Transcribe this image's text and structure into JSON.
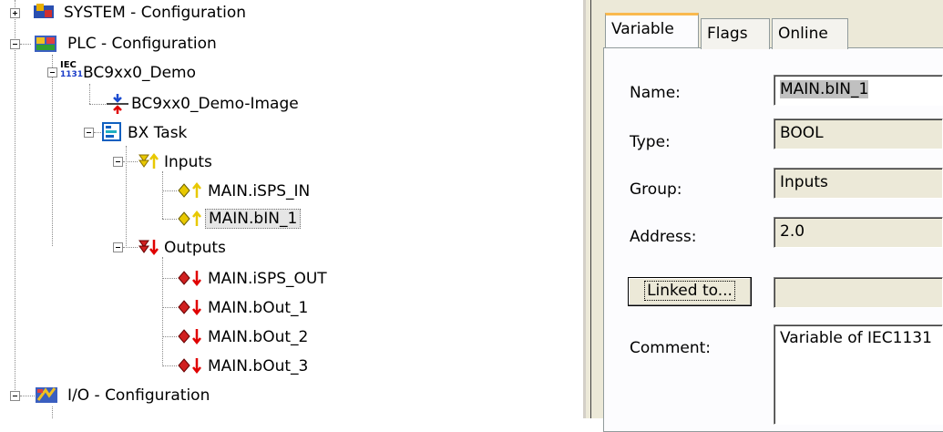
{
  "tree": {
    "system": "SYSTEM - Configuration",
    "plc": "PLC - Configuration",
    "project": "BC9xx0_Demo",
    "image": "BC9xx0_Demo-Image",
    "task": "BX Task",
    "inputs": "Inputs",
    "in1": "MAIN.iSPS_IN",
    "in2": "MAIN.bIN_1",
    "outputs": "Outputs",
    "out1": "MAIN.iSPS_OUT",
    "out2": "MAIN.bOut_1",
    "out3": "MAIN.bOut_2",
    "out4": "MAIN.bOut_3",
    "io": "I/O - Configuration",
    "iec_icon_text_top": "IEC",
    "iec_icon_text_bottom": "1131"
  },
  "tabs": [
    "Variable",
    "Flags",
    "Online"
  ],
  "form": {
    "name_label": "Name:",
    "name_value": "MAIN.bIN_1",
    "type_label": "Type:",
    "type_value": "BOOL",
    "group_label": "Group:",
    "group_value": "Inputs",
    "address_label": "Address:",
    "address_value": "2.0",
    "linked_button": "Linked to...",
    "linked_value": "",
    "comment_label": "Comment:",
    "comment_value": "Variable of IEC1131"
  },
  "colors": {
    "tab_active_accent": "#f9b94e",
    "panel_bg": "#ece9d8",
    "input_arrow": "#e8c800",
    "output_arrow": "#e00000"
  }
}
